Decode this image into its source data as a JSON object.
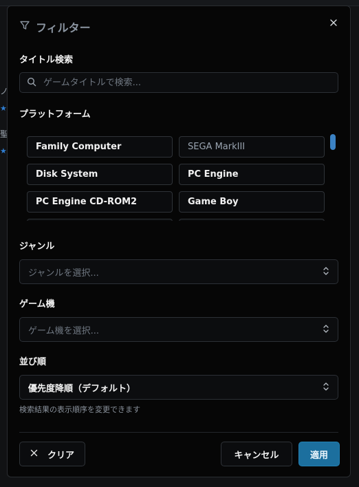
{
  "background": {
    "fragments": [
      "ノ",
      "聖"
    ]
  },
  "modal": {
    "title": "フィルター",
    "icon": "filter-icon",
    "close_icon": "close-icon"
  },
  "title_search": {
    "label": "タイトル検索",
    "placeholder": "ゲームタイトルで検索...",
    "value": "",
    "icon": "search-icon"
  },
  "platform": {
    "label": "プラットフォーム",
    "items": [
      {
        "label": "Family Computer"
      },
      {
        "label": "SEGA MarkIII"
      },
      {
        "label": "Disk System"
      },
      {
        "label": "PC Engine"
      },
      {
        "label": "PC Engine CD-ROM2"
      },
      {
        "label": "Game Boy"
      }
    ]
  },
  "genre": {
    "label": "ジャンル",
    "placeholder": "ジャンルを選択..."
  },
  "console": {
    "label": "ゲーム機",
    "placeholder": "ゲーム機を選択..."
  },
  "sort": {
    "label": "並び順",
    "value": "優先度降順（デフォルト）",
    "helper": "検索結果の表示順序を変更できます"
  },
  "footer": {
    "clear_label": "クリア",
    "cancel_label": "キャンセル",
    "apply_label": "適用"
  },
  "colors": {
    "accent": "#1c6f9e",
    "scroll_thumb": "#3b82c4",
    "border": "#2f3338"
  }
}
